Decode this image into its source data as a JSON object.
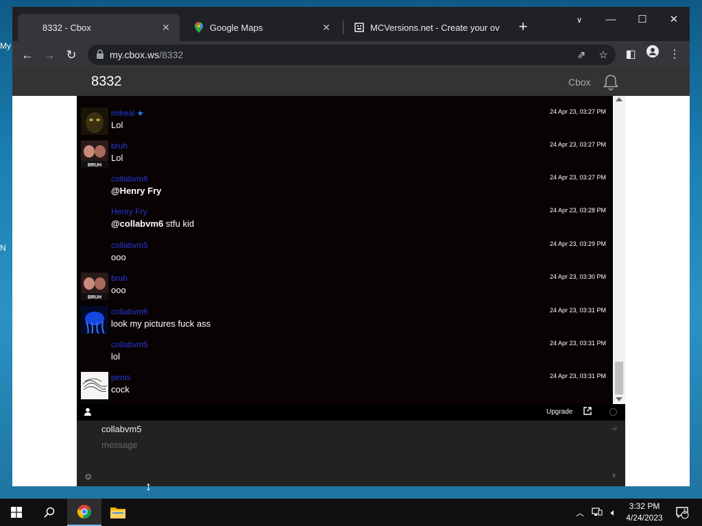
{
  "desktop": {
    "labels": [
      "My",
      "N"
    ]
  },
  "browser": {
    "tabs": [
      {
        "title": "8332 - Cbox",
        "icon": "none",
        "active": true
      },
      {
        "title": "Google Maps",
        "icon": "maps-pin-icon",
        "active": false
      },
      {
        "title": "MCVersions.net - Create your ov",
        "icon": "mcversions-icon",
        "active": false
      }
    ],
    "new_tab_label": "+",
    "url_host": "my.cbox.ws",
    "url_path": "/8332"
  },
  "cbox": {
    "title": "8332",
    "header_link": "Cbox",
    "messages": [
      {
        "name": "mikeal",
        "starred": true,
        "time": "24 Apr 23, 03:27 PM",
        "mention": "",
        "text": "Lol",
        "avatar": "dark-creature-avatar"
      },
      {
        "name": "bruh",
        "starred": false,
        "time": "24 Apr 23, 03:27 PM",
        "mention": "",
        "text": "Lol",
        "avatar": "bruh-avatar"
      },
      {
        "name": "collabvm6",
        "starred": false,
        "time": "24 Apr 23, 03:27 PM",
        "mention": "@Henry Fry",
        "text": "",
        "avatar": "none"
      },
      {
        "name": "Henry Fry",
        "starred": false,
        "time": "24 Apr 23, 03:28 PM",
        "mention": "@collabvm6",
        "text": " stfu kid",
        "avatar": "none"
      },
      {
        "name": "collabvm5",
        "starred": false,
        "time": "24 Apr 23, 03:29 PM",
        "mention": "",
        "text": "ooo",
        "avatar": "none"
      },
      {
        "name": "bruh",
        "starred": false,
        "time": "24 Apr 23, 03:30 PM",
        "mention": "",
        "text": "ooo",
        "avatar": "bruh-avatar"
      },
      {
        "name": "collabvm6",
        "starred": false,
        "time": "24 Apr 23, 03:31 PM",
        "mention": "",
        "text": "look my pictures fuck ass",
        "avatar": "blue-jellyfish-avatar"
      },
      {
        "name": "collabvm5",
        "starred": false,
        "time": "24 Apr 23, 03:31 PM",
        "mention": "",
        "text": "lol",
        "avatar": "none"
      },
      {
        "name": "penis",
        "starred": false,
        "time": "24 Apr 23, 03:31 PM",
        "mention": "",
        "text": "cock",
        "avatar": "scribble-avatar"
      }
    ],
    "bar": {
      "upgrade_label": "Upgrade"
    },
    "compose": {
      "username": "collabvm5",
      "placeholder": "message"
    }
  },
  "taskbar": {
    "time": "3:32 PM",
    "date": "4/24/2023",
    "notification_count": "1"
  },
  "colors": {
    "name_link": "#2538d6",
    "chat_bg": "#090203",
    "header_bg": "#333333",
    "accent": "#76b9ed"
  }
}
